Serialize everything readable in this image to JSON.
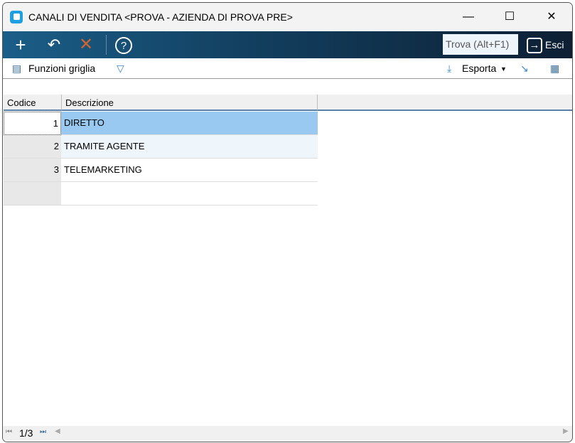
{
  "window": {
    "title": "CANALI DI VENDITA <PROVA - AZIENDA DI PROVA PRE>"
  },
  "toolbar": {
    "find_placeholder": "Trova (Alt+F1)",
    "exit_label": "Esci"
  },
  "subtoolbar": {
    "grid_functions_label": "Funzioni griglia",
    "export_label": "Esporta"
  },
  "grid": {
    "columns": [
      "Codice",
      "Descrizione"
    ],
    "rows": [
      {
        "codice": "1",
        "descrizione": "DIRETTO"
      },
      {
        "codice": "2",
        "descrizione": "TRAMITE AGENTE"
      },
      {
        "codice": "3",
        "descrizione": "TELEMARKETING"
      }
    ]
  },
  "pager": {
    "page": "1/3"
  },
  "colors": {
    "selected": "#99c9f0",
    "alt_row": "#eef6fc"
  }
}
